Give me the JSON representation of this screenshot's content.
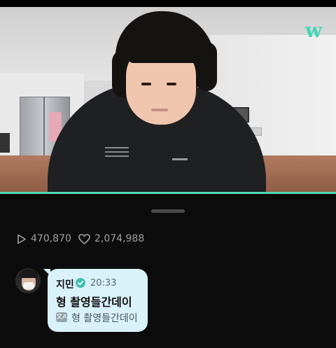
{
  "app": {
    "logo_letter": "w",
    "accent_color": "#52d6b0",
    "logo_color": "#3fd6b8"
  },
  "stats": {
    "views": "470,870",
    "likes": "2,074,988",
    "views_icon": "play-icon",
    "likes_icon": "heart-icon"
  },
  "comment": {
    "author": "지민",
    "verified_icon": "verified-badge-icon",
    "time": "20:33",
    "message": "형 촬영들간데이",
    "translation_icon": "translate-icon",
    "translation_icon_text": "文A",
    "translation": "형 촬영들간데이",
    "bubble_color": "#d9f1f8"
  }
}
